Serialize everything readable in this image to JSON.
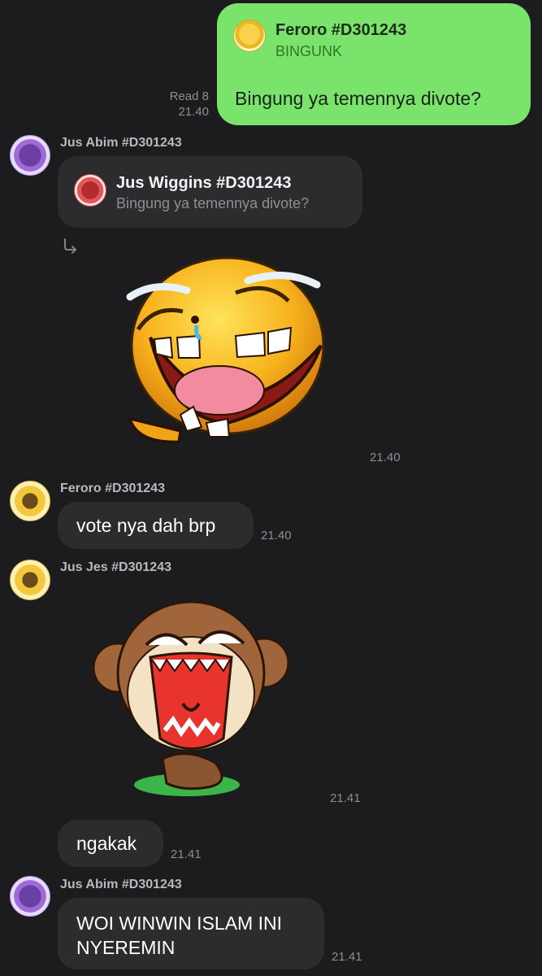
{
  "outgoing": {
    "quote_name": "Feroro #D301243",
    "quote_text": "BINGUNK",
    "text": "Bingung ya temennya divote?",
    "read_label": "Read 8",
    "time": "21.40",
    "bubble_color": "#79e36c"
  },
  "messages": [
    {
      "sender": "Jus Abim #D301243",
      "quote_name": "Jus Wiggins #D301243",
      "quote_text": "Bingung ya temennya divote?",
      "reply_icon": "reply-arrow-icon"
    },
    {
      "sticker": "crying-laughing-emoji-sticker",
      "time": "21.40"
    },
    {
      "sender": "Feroro #D301243",
      "text": "vote nya dah brp",
      "time": "21.40"
    },
    {
      "sender": "Jus Jes #D301243",
      "sticker": "laughing-monkey-sticker",
      "time": "21.41"
    },
    {
      "text": "ngakak",
      "time": "21.41"
    },
    {
      "sender": "Jus Abim #D301243",
      "text_line1": "WOI WINWIN ISLAM INI",
      "text_line2": "NYEREMIN",
      "time": "21.41"
    }
  ],
  "colors": {
    "background": "#1c1c1e",
    "incoming_bubble": "#2c2c2e",
    "accent_green": "#79e36c"
  }
}
